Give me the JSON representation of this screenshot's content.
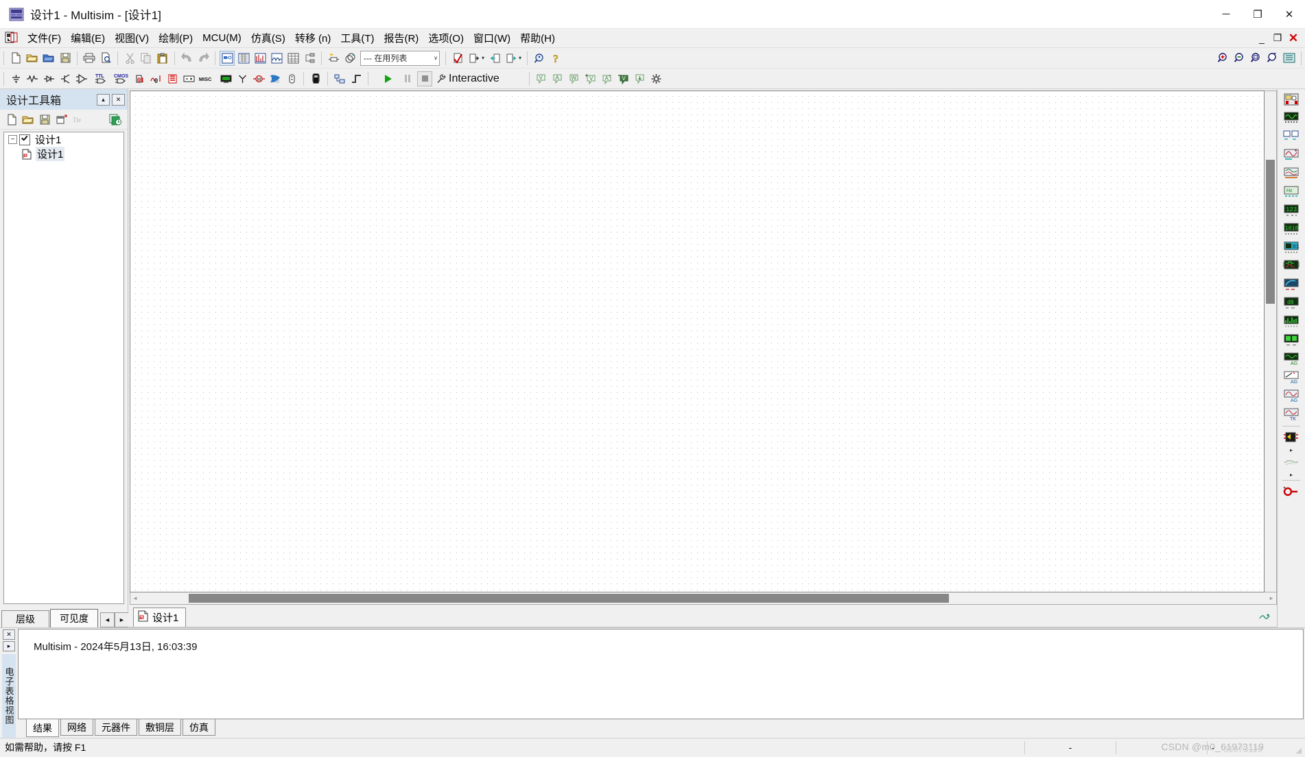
{
  "window": {
    "title": "设计1 - Multisim - [设计1]",
    "minimize": "─",
    "maximize": "❐",
    "close": "✕",
    "app_icon": "multisim-logo-icon"
  },
  "menubar": {
    "doc_icon": "document-window-icon",
    "items": [
      {
        "label": "文件(F)",
        "name": "menu-file"
      },
      {
        "label": "编辑(E)",
        "name": "menu-edit"
      },
      {
        "label": "视图(V)",
        "name": "menu-view"
      },
      {
        "label": "绘制(P)",
        "name": "menu-place"
      },
      {
        "label": "MCU(M)",
        "name": "menu-mcu"
      },
      {
        "label": "仿真(S)",
        "name": "menu-simulate"
      },
      {
        "label": "转移 (n)",
        "name": "menu-transfer"
      },
      {
        "label": "工具(T)",
        "name": "menu-tools"
      },
      {
        "label": "报告(R)",
        "name": "menu-reports"
      },
      {
        "label": "选项(O)",
        "name": "menu-options"
      },
      {
        "label": "窗口(W)",
        "name": "menu-window"
      },
      {
        "label": "帮助(H)",
        "name": "menu-help"
      }
    ],
    "mdi": {
      "minimize": "_",
      "restore": "❐",
      "close": "✕"
    }
  },
  "toolbar_standard": {
    "groups": [
      [
        "new-file-icon",
        "open-file-icon",
        "open-design-folder-icon",
        "save-icon"
      ],
      [
        "print-icon",
        "print-preview-icon"
      ],
      [
        "cut-icon",
        "copy-icon",
        "paste-icon"
      ],
      [
        "undo-icon",
        "redo-icon"
      ]
    ]
  },
  "toolbar_view": {
    "items": [
      "toggle-schematic-icon",
      "grapher-icon",
      "analysis-icon",
      "postprocessor-icon",
      "spreadsheet-view-icon",
      "hierarchy-icon"
    ]
  },
  "toolbar_place": {
    "items": [
      "place-component-icon",
      "place-junction-icon"
    ],
    "in_use_list": {
      "value": "--- 在用列表",
      "placeholder": "--- 在用列表",
      "caret": "∨"
    }
  },
  "toolbar_check": {
    "items": [
      "erc-check-icon",
      "export-netlist-icon",
      "backward-annotate-icon",
      "forward-annotate-icon"
    ],
    "carets": "▾"
  },
  "toolbar_help": {
    "items": [
      "find-icon",
      "help-icon"
    ]
  },
  "toolbar_zoom": {
    "items": [
      "zoom-in-icon",
      "zoom-out-icon",
      "zoom-fit-icon",
      "zoom-area-icon",
      "zoom-sheet-icon"
    ]
  },
  "toolbar_components": {
    "items": [
      "sources-icon",
      "basic-passive-icon",
      "diodes-icon",
      "transistors-icon",
      "analog-icon",
      "ttl-icon",
      "cmos-icon",
      "misc-digital-icon",
      "mixed-icon",
      "indicators-icon",
      "power-icon",
      "misc-components-icon",
      "advanced-peripherals-icon",
      "rf-icon",
      "electromechanical-icon",
      "ni-components-icon",
      "connectors-icon",
      "mcu-icon",
      "hierarchical-block-icon",
      "bus-icon"
    ]
  },
  "toolbar_simulation": {
    "run_icon": "run-simulation-icon",
    "pause_icon": "pause-simulation-icon",
    "stop_icon": "stop-simulation-icon",
    "analysis_icon": "active-analysis-wrench-icon",
    "analysis_label": "Interactive"
  },
  "toolbar_probes": {
    "items": [
      "voltage-probe-icon",
      "current-probe-icon",
      "power-probe-icon",
      "differential-voltage-probe-icon",
      "current-gain-probe-icon",
      "referenced-voltage-probe-icon",
      "digital-probe-icon",
      "probe-settings-icon"
    ]
  },
  "design_toolbox": {
    "title": "设计工具箱",
    "collapse_btn": "▴",
    "close_btn": "✕",
    "toolbar": [
      "new-design-icon",
      "open-design-icon",
      "save-design-icon",
      "new-sheet-icon",
      "rename-icon",
      "sheet-history-icon"
    ],
    "tree": {
      "root": {
        "label": "设计1",
        "expander": "−",
        "icon": "design-checkbox-icon"
      },
      "child": {
        "label": "设计1",
        "icon": "schematic-sheet-icon"
      }
    },
    "tabs": [
      {
        "label": "层级",
        "active": false,
        "name": "tab-hierarchy"
      },
      {
        "label": "可见度",
        "active": true,
        "name": "tab-visibility"
      }
    ],
    "spinner": {
      "left": "◄",
      "right": "►"
    }
  },
  "canvas": {
    "doc_tab": {
      "label": "设计1",
      "icon": "schematic-sheet-icon"
    },
    "right_status_icon": "schematic-status-icon",
    "scroll_left_arrow": "◄",
    "scroll_right_arrow": "►"
  },
  "right_palette": {
    "items": [
      "multimeter-icon",
      "function-generator-icon",
      "wattmeter-icon",
      "oscilloscope-icon",
      "four-channel-oscilloscope-icon",
      "bode-plotter-icon",
      "frequency-counter-icon",
      "word-generator-icon",
      "logic-converter-icon",
      "logic-analyzer-icon",
      "iv-analyzer-icon",
      "distortion-analyzer-icon",
      "spectrum-analyzer-icon",
      "network-analyzer-icon",
      "agilent-function-generator-icon",
      "agilent-multimeter-icon",
      "agilent-oscilloscope-icon",
      "tektronix-oscilloscope-icon",
      "labview-instruments-icon",
      "ni-elvismx-instruments-icon",
      "current-probe-tool-icon"
    ],
    "dropdown_arrow": "▸"
  },
  "spreadsheet_view": {
    "close_btn": "✕",
    "expand_btn": "▸",
    "vertical_title": "电子表格视图",
    "content": "Multisim  -  2024年5月13日, 16:03:39",
    "tabs": [
      {
        "label": "结果",
        "active": true,
        "name": "tab-results"
      },
      {
        "label": "网络",
        "active": false,
        "name": "tab-nets"
      },
      {
        "label": "元器件",
        "active": false,
        "name": "tab-components"
      },
      {
        "label": "敷铜层",
        "active": false,
        "name": "tab-copper-layers"
      },
      {
        "label": "仿真",
        "active": false,
        "name": "tab-simulation"
      }
    ]
  },
  "statusbar": {
    "message": "如需帮助，请按 F1",
    "cell1": "-",
    "cell2": "",
    "cell3": "-",
    "watermark": "CSDN @m0_61973119",
    "watermark_overlay": "61973119"
  },
  "colors": {
    "accent": "#d5e3f0",
    "chrome": "#f0f0f0",
    "canvas": "#ffffff",
    "grid_dot": "#b9b9b9",
    "run_green": "#13a313",
    "close_red": "#e81123"
  }
}
